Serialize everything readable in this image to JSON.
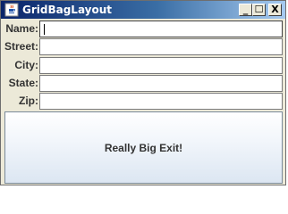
{
  "window": {
    "title": "GridBagLayout",
    "controls": {
      "minimize": "_",
      "maximize": "☐",
      "close": "X"
    }
  },
  "form": {
    "fields": [
      {
        "label": "Name:",
        "value": ""
      },
      {
        "label": "Street:",
        "value": ""
      },
      {
        "label": "City:",
        "value": ""
      },
      {
        "label": "State:",
        "value": ""
      },
      {
        "label": "Zip:",
        "value": ""
      }
    ]
  },
  "exit_button": {
    "label": "Really Big Exit!"
  },
  "icons": {
    "app": "java-coffee-cup-icon"
  },
  "colors": {
    "titlebar_start": "#0a246a",
    "titlebar_end": "#a6caf0",
    "window_bg": "#ece9d8"
  }
}
